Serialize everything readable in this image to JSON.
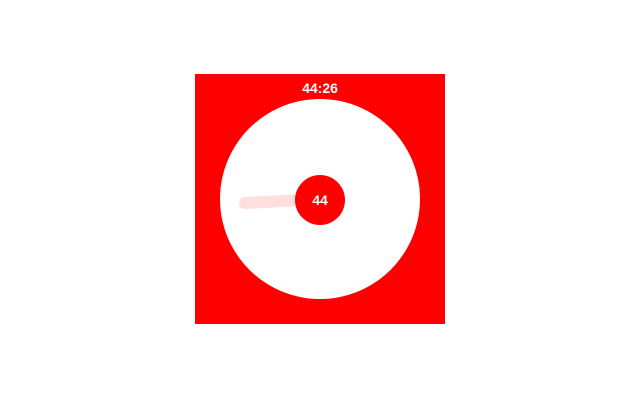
{
  "timer": {
    "display": "44:26",
    "minutes_label": "44",
    "minutes": 44,
    "seconds": 26
  },
  "colors": {
    "background": "#ff0000",
    "dial_face": "#ffffff",
    "hand": "#ffdede",
    "knob": "#ff0000",
    "text": "#ffffff"
  }
}
